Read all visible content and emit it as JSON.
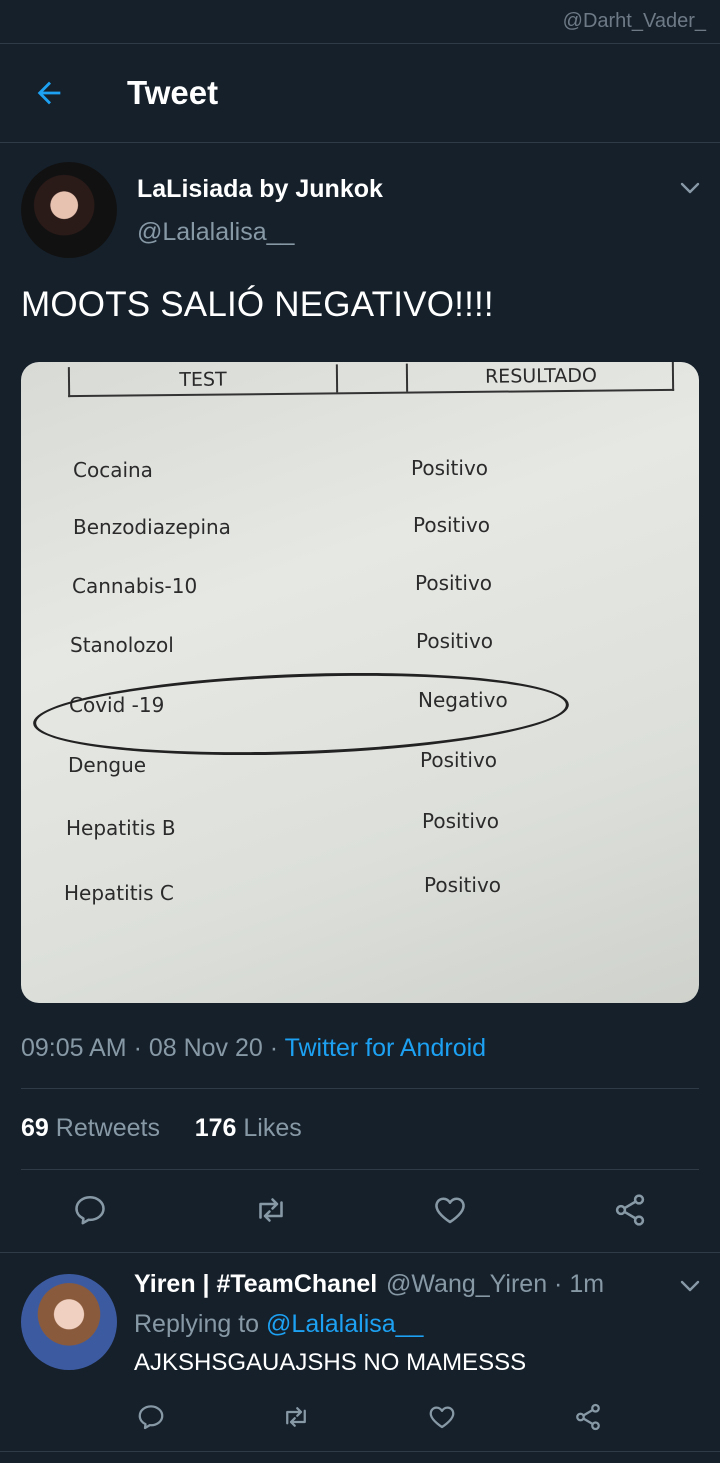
{
  "watermark": "@Darht_Vader_",
  "header": {
    "title": "Tweet"
  },
  "tweet": {
    "author_name": "LaLisiada by Junkok",
    "author_handle": "@Lalalalisa__",
    "text": "MOOTS SALIÓ NEGATIVO!!!!",
    "photo": {
      "col_test": "TEST",
      "col_result": "RESULTADO",
      "rows": [
        {
          "test": "Cocaina",
          "result": "Positivo"
        },
        {
          "test": "Benzodiazepina",
          "result": "Positivo"
        },
        {
          "test": "Cannabis-10",
          "result": "Positivo"
        },
        {
          "test": "Stanolozol",
          "result": "Positivo"
        },
        {
          "test": "Covid -19",
          "result": "Negativo"
        },
        {
          "test": "Dengue",
          "result": "Positivo"
        },
        {
          "test": "Hepatitis B",
          "result": "Positivo"
        },
        {
          "test": "Hepatitis C",
          "result": "Positivo"
        }
      ]
    },
    "time": "09:05 AM · 08 Nov 20 · ",
    "app": "Twitter for Android",
    "retweets_count": "69",
    "retweets_label": "Retweets",
    "likes_count": "176",
    "likes_label": "Likes"
  },
  "reply": {
    "author_name": "Yiren | #TeamChanel",
    "author_handle": "@Wang_Yiren · 1m",
    "replying_prefix": "Replying to ",
    "replying_mention": "@Lalalalisa__",
    "text": "AJKSHSGAUAJSHS NO MAMESSS"
  },
  "colors": {
    "background": "#15202b",
    "accent": "#1da1f2",
    "muted": "#8899a6"
  },
  "icons": [
    "back-arrow-icon",
    "chevron-down-icon",
    "reply-icon",
    "retweet-icon",
    "like-icon",
    "share-icon"
  ]
}
